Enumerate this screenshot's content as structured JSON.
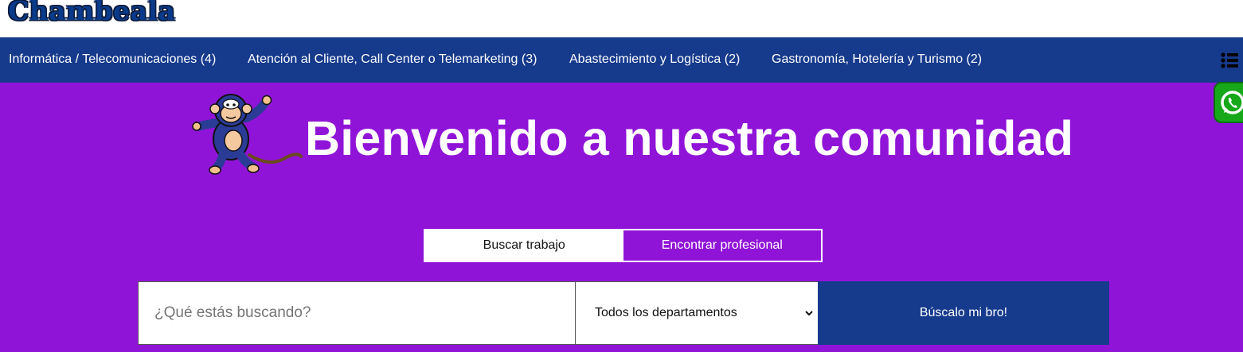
{
  "brand": {
    "logo_text": "Chambeala"
  },
  "nav": {
    "items": [
      {
        "label": "Informática / Telecomunicaciones (4)"
      },
      {
        "label": "Atención al Cliente, Call Center o Telemarketing (3)"
      },
      {
        "label": "Abastecimiento y Logística (2)"
      },
      {
        "label": "Gastronomía, Hotelería y Turismo (2)"
      }
    ],
    "menu_icon": "list-icon"
  },
  "hero": {
    "title": "Bienvenido a nuestra comunidad",
    "mascot_icon": "monkey-mascot",
    "whatsapp_icon": "whatsapp-icon"
  },
  "search": {
    "tabs": [
      {
        "label": "Buscar trabajo",
        "active": true
      },
      {
        "label": "Encontrar profesional",
        "active": false
      }
    ],
    "placeholder": "¿Qué estás buscando?",
    "department_selected": "Todos los departamentos",
    "button_label": "Búscalo mi bro!"
  },
  "colors": {
    "nav_bg": "#163a8c",
    "hero_bg": "#9014d7",
    "whatsapp": "#17a81a"
  }
}
